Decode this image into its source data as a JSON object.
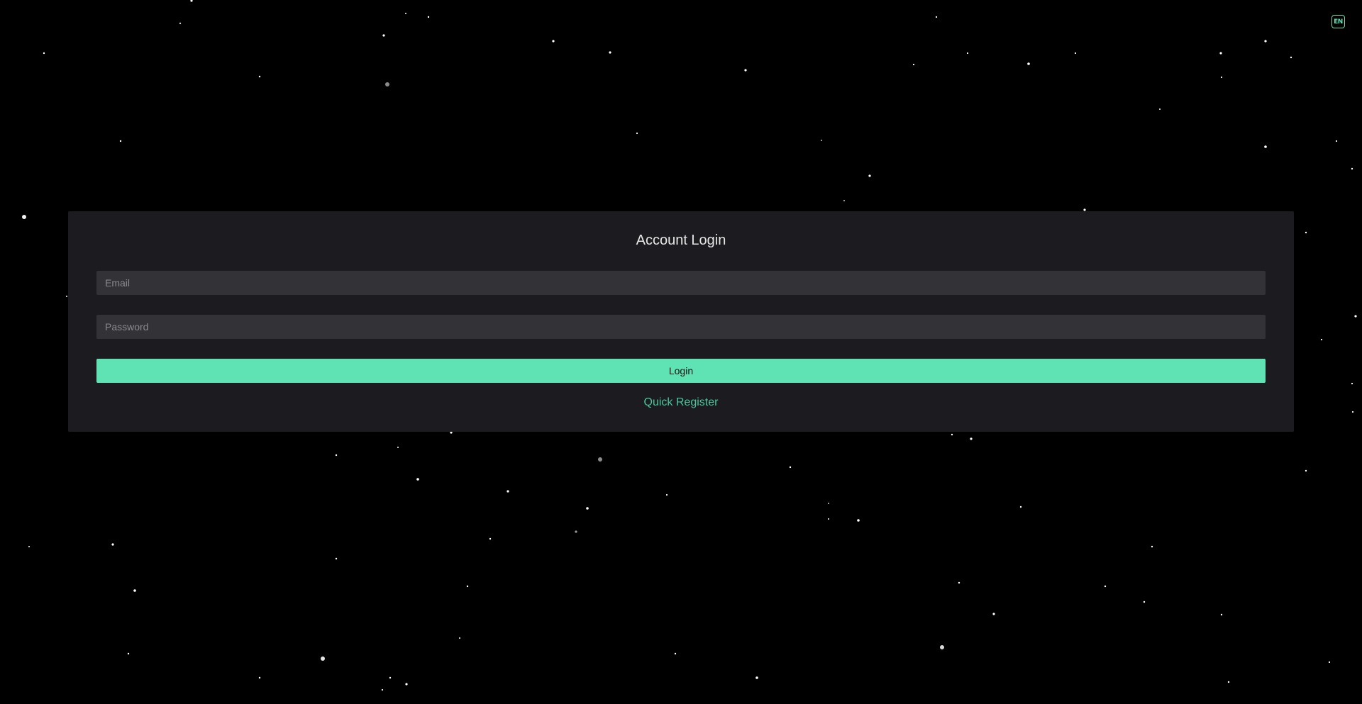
{
  "header": {
    "language_label": "EN",
    "language_icon": "language-icon"
  },
  "login": {
    "title": "Account Login",
    "email_placeholder": "Email",
    "email_value": "",
    "password_placeholder": "Password",
    "password_value": "",
    "submit_label": "Login",
    "register_label": "Quick Register"
  },
  "colors": {
    "background": "#000000",
    "card": "#1c1c20",
    "input": "#333337",
    "accent": "#5fe3b5",
    "link": "#49c79b"
  }
}
